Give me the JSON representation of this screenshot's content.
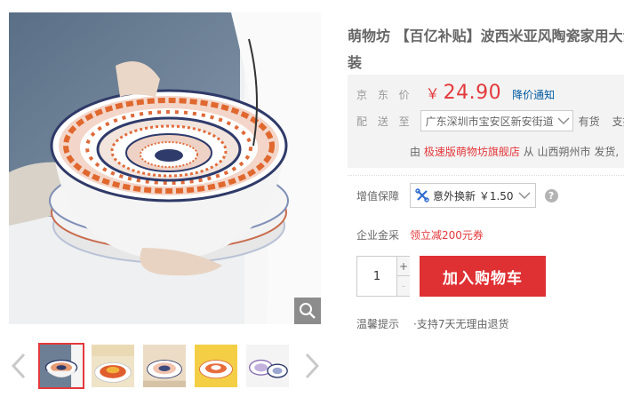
{
  "product": {
    "title_line1": "萌物坊 【百亿补贴】波西米亚风陶瓷家用大汤碗",
    "title_line2": "装"
  },
  "price": {
    "label": "京 东 价",
    "currency": "￥",
    "amount": "24.90",
    "notify_link": "降价通知"
  },
  "shipping": {
    "label": "配 送 至",
    "address": "广东深圳市宝安区新安街道",
    "stock": "有货",
    "support": "支持"
  },
  "seller": {
    "prefix": "由",
    "shop": "极速版萌物坊旗舰店",
    "from": "从",
    "origin": "山西朔州市",
    "suffix": "发货,"
  },
  "value_added": {
    "label": "增值保障",
    "option": "意外换新 ￥1.50",
    "help": "?"
  },
  "enterprise": {
    "label": "企业金采",
    "coupon": "领立减200元券"
  },
  "quantity": {
    "value": "1",
    "plus": "+",
    "minus": "-"
  },
  "cart": {
    "button_label": "加入购物车"
  },
  "tips": {
    "label": "温馨提示",
    "item": "·支持7天无理由退货"
  },
  "gallery": {
    "thumbnail_count": 5,
    "active_index": 0,
    "icons": [
      "zoom-icon",
      "chevron-left-icon",
      "chevron-right-icon"
    ]
  },
  "colors": {
    "accent_red": "#e4393c",
    "cart_red": "#df3033",
    "link_blue": "#005aa0",
    "price_box_bg": "#f3f3f3"
  }
}
